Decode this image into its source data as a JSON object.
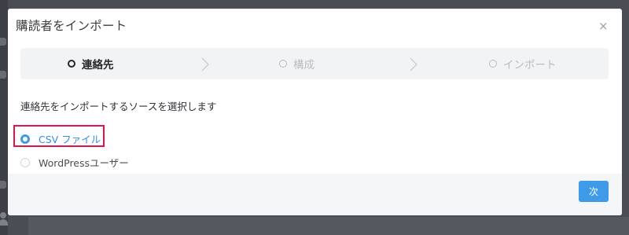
{
  "dialog": {
    "title": "購読者をインポート",
    "close_label": "×"
  },
  "steps": [
    {
      "label": "連絡先",
      "state": "active"
    },
    {
      "label": "構成",
      "state": "inactive"
    },
    {
      "label": "インポート",
      "state": "inactive"
    }
  ],
  "source": {
    "prompt": "連絡先をインポートするソースを選択します",
    "options": [
      {
        "label": "CSV ファイル",
        "selected": true
      },
      {
        "label": "WordPressユーザー",
        "selected": false
      }
    ]
  },
  "footer": {
    "next_label": "次"
  },
  "colors": {
    "accent": "#3f9ae8",
    "highlight": "#e2124f",
    "overlay": "#4a4d53"
  }
}
